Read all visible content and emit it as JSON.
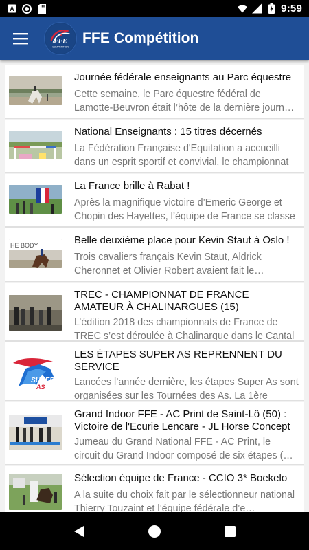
{
  "status_bar": {
    "time": "9:59",
    "icons": [
      "a-letter-icon",
      "record-icon",
      "sd-card-icon",
      "wifi-icon",
      "cell-signal-icon",
      "battery-icon"
    ]
  },
  "app_bar": {
    "title": "FFE Compétition",
    "logo_text": "FFE",
    "logo_subtext": "COMPÉTITION",
    "color": "#1f4e96"
  },
  "articles": [
    {
      "title": "Journée fédérale enseignants au Parc équestre",
      "excerpt": "Cette semaine, le Parc équestre fédéral de Lamotte-Beuvron était l’hôte de la dernière journée fédérale enseignants"
    },
    {
      "title": "National Enseignants : 15 titres décernés",
      "excerpt": "La Fédération Française d'Equitation a accueilli dans un esprit sportif et convivial, le championnat"
    },
    {
      "title": "La France brille à Rabat !",
      "excerpt": "Après la magnifique victoire d’Emeric George et Chopin des Hayettes, l’équipe de France se classe"
    },
    {
      "title": "Belle deuxième place pour Kevin Staut à Oslo !",
      "excerpt": "Trois cavaliers français Kevin Staut, Aldrick Cheronnet et Olivier Robert avaient fait le déplacement"
    },
    {
      "title": "TREC - CHAMPIONNAT DE FRANCE AMATEUR À CHALINARGUES (15)",
      "excerpt": "L’édition 2018 des championnats de France de TREC s’est déroulée à Chalinargue dans le Cantal"
    },
    {
      "title": "LES ÉTAPES SUPER AS REPRENNENT DU SERVICE",
      "excerpt": "Lancées l’année dernière, les étapes Super As sont organisées sur les Tournées des As. La 1ère"
    },
    {
      "title": "Grand Indoor FFE - AC Print de Saint-Lô (50) : Victoire de l'Ecurie Lencare - JL Horse Concept",
      "excerpt": "Jumeau du Grand National FFE - AC Print, le circuit du Grand Indoor composé de six étapes (…"
    },
    {
      "title": "Sélection équipe de France - CCIO 3* Boekelo",
      "excerpt": "A la suite du choix fait par le sélectionneur national Thierry Touzaint et l’équipe fédérale d’e…"
    }
  ],
  "nav_bar": {
    "icons": [
      "back-icon",
      "home-icon",
      "recents-icon"
    ]
  }
}
